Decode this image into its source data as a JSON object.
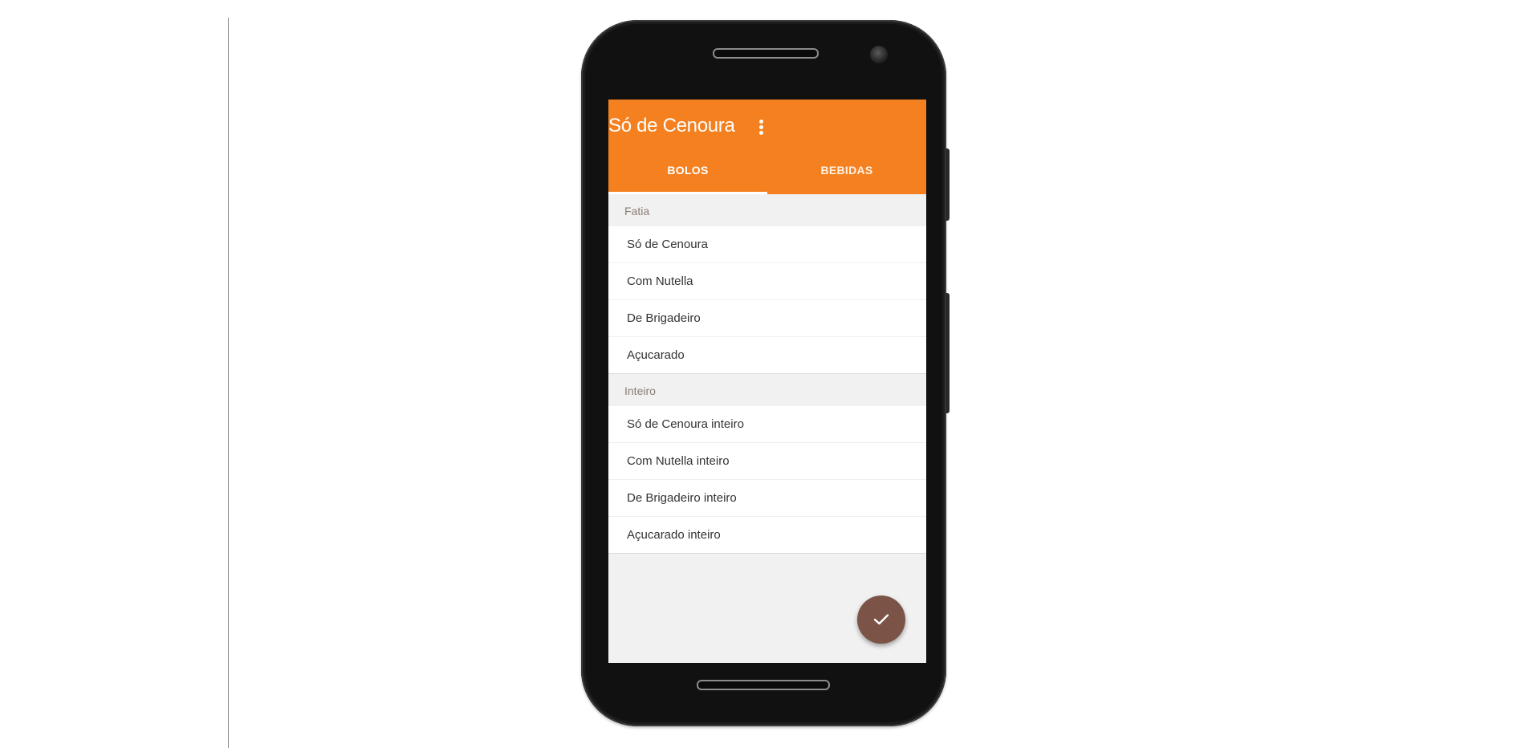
{
  "app": {
    "title": "Só de Cenoura"
  },
  "tabs": [
    {
      "label": "BOLOS"
    },
    {
      "label": "BEBIDAS"
    }
  ],
  "sections": [
    {
      "header": "Fatia",
      "items": [
        "Só de Cenoura",
        "Com Nutella",
        "De Brigadeiro",
        "Açucarado"
      ]
    },
    {
      "header": "Inteiro",
      "items": [
        "Só de Cenoura inteiro",
        "Com Nutella inteiro",
        "De Brigadeiro inteiro",
        "Açucarado inteiro"
      ]
    }
  ],
  "icons": {
    "overflow": "more-vertical-icon",
    "fab": "check-icon"
  },
  "colors": {
    "primary": "#f4801f",
    "accent": "#7b5447",
    "background": "#f1f1f1"
  }
}
